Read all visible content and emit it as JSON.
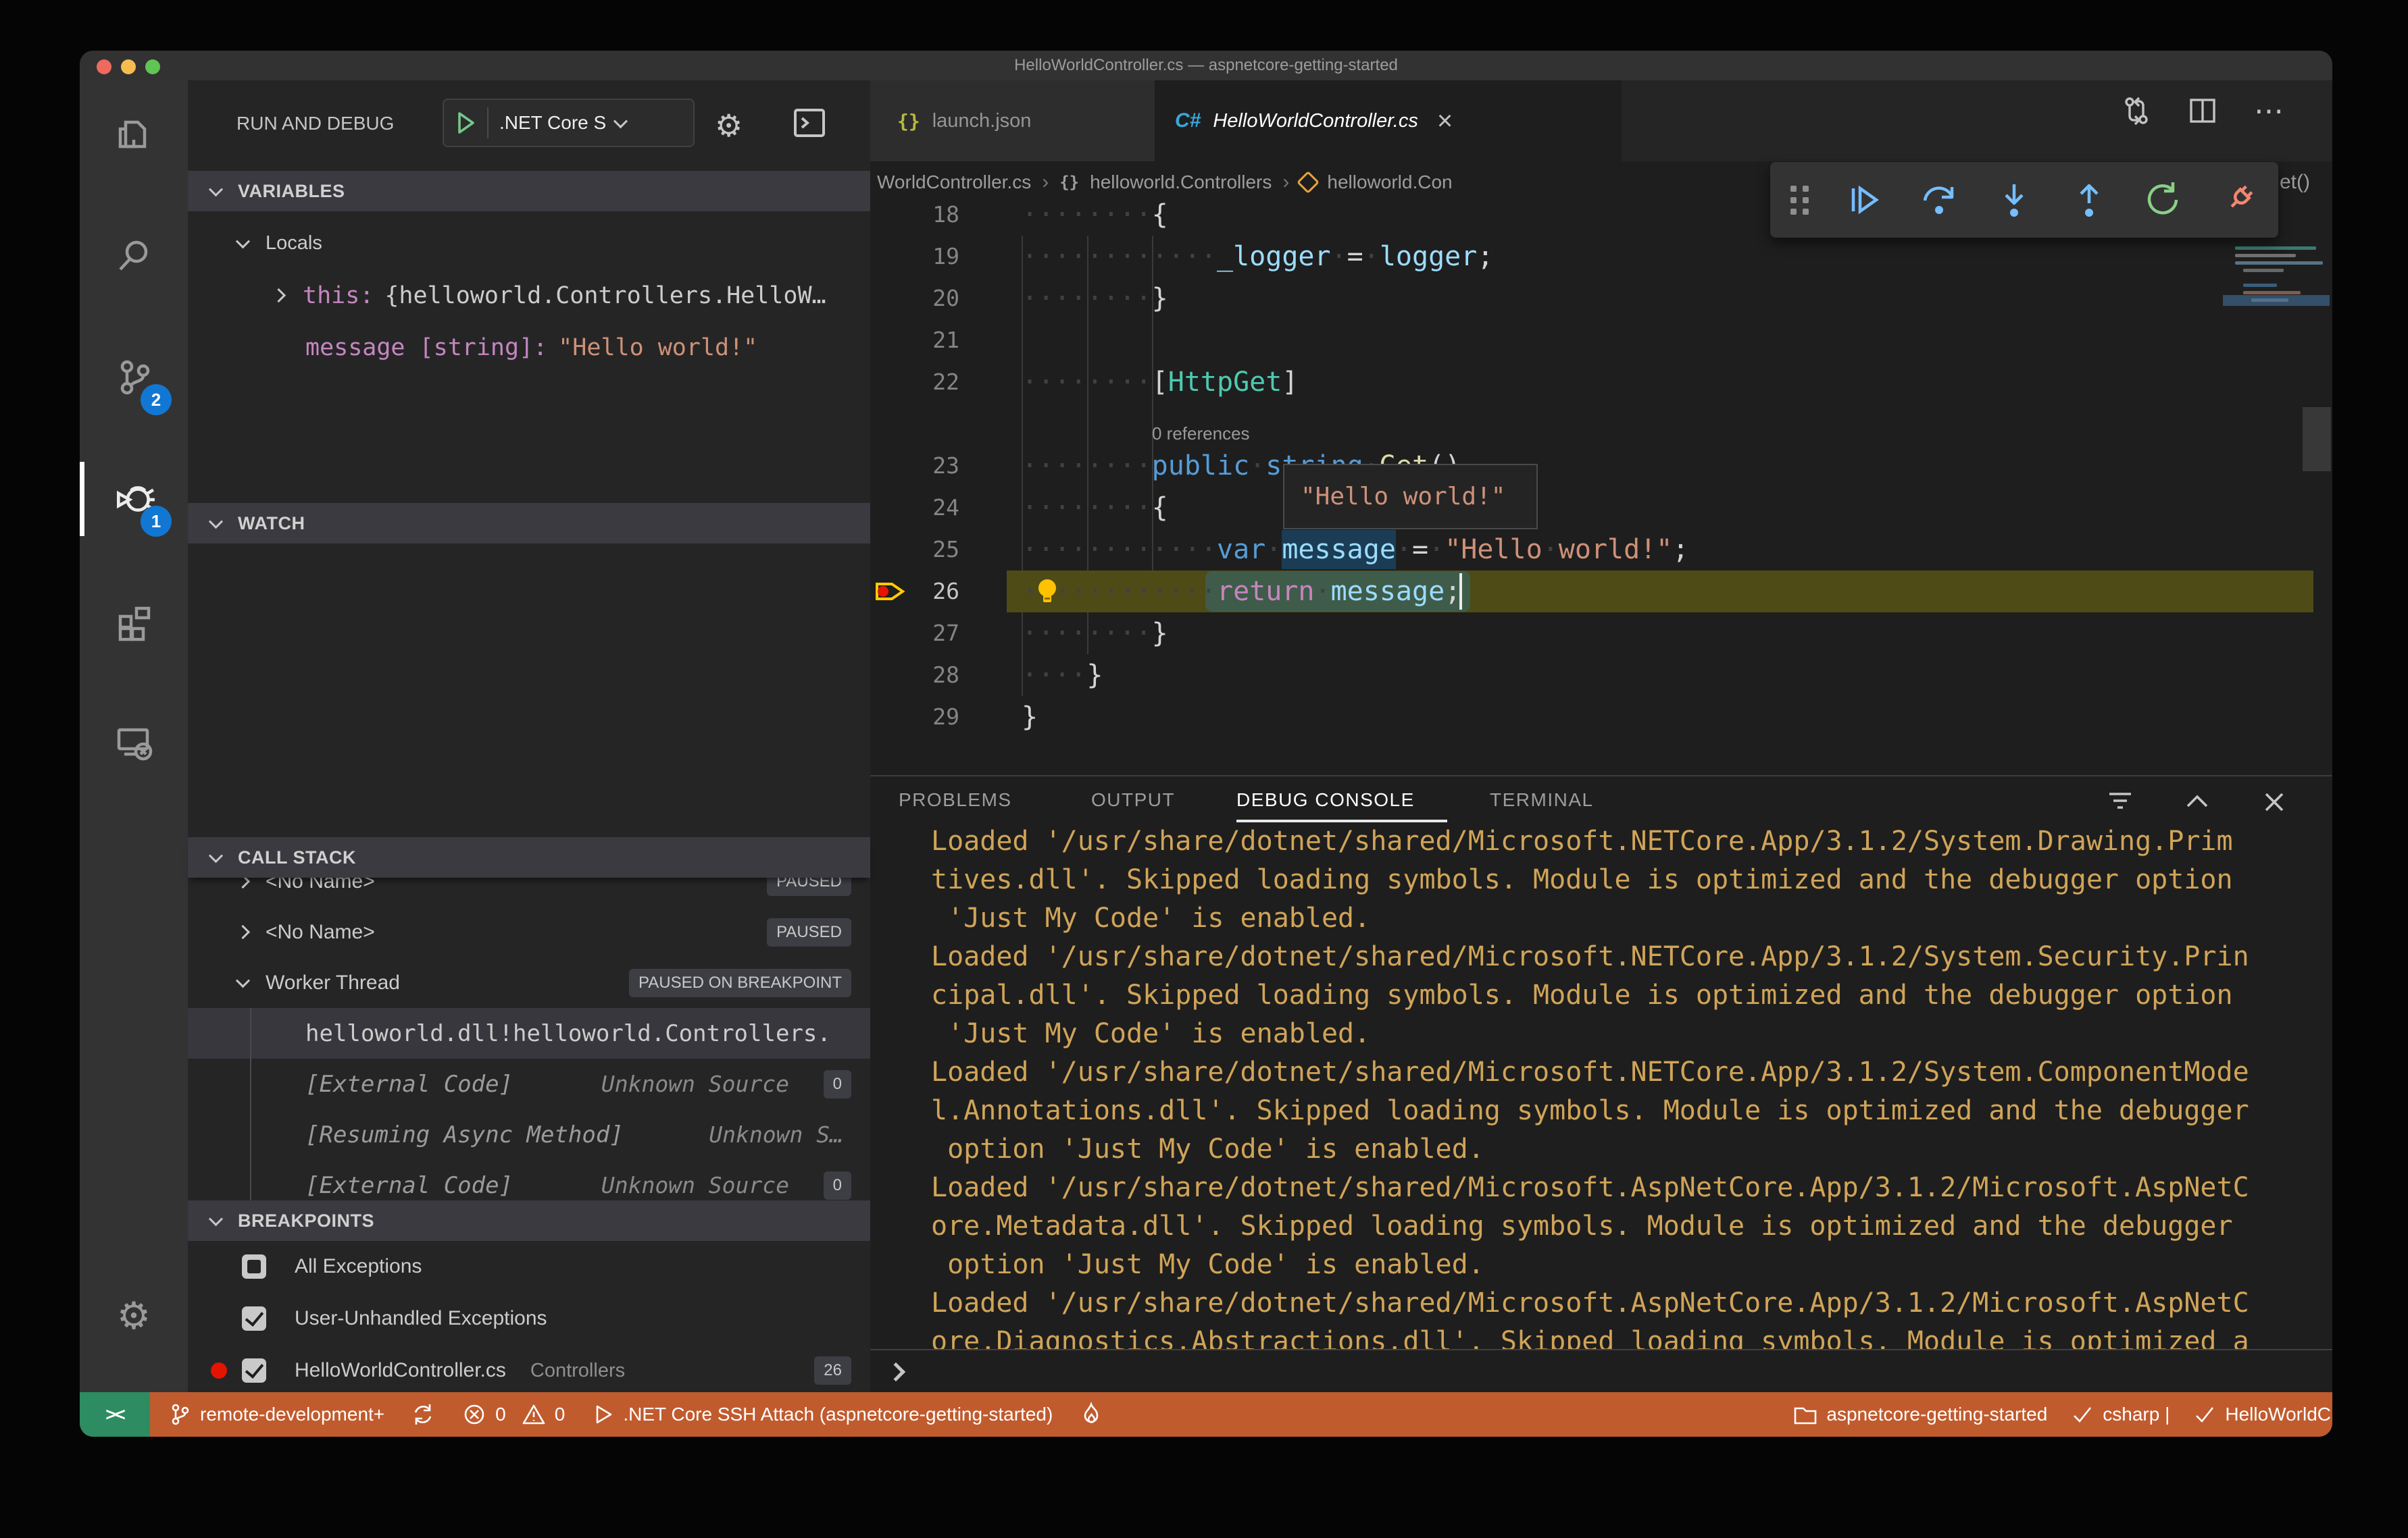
{
  "window": {
    "title": "HelloWorldController.cs — aspnetcore-getting-started"
  },
  "activity_bar": {
    "scm_badge": "2",
    "debug_badge": "1"
  },
  "run_bar": {
    "title": "RUN AND DEBUG",
    "config": ".NET Core S"
  },
  "sections": {
    "variables": "VARIABLES",
    "watch": "WATCH",
    "call_stack": "CALL STACK",
    "breakpoints": "BREAKPOINTS"
  },
  "variables": {
    "scope": "Locals",
    "rows": [
      {
        "name": "this:",
        "value": "{helloworld.Controllers.HelloW…"
      },
      {
        "name": "message [string]:",
        "value": "\"Hello world!\""
      }
    ]
  },
  "call_stack": {
    "rows": [
      {
        "label": "<No Name>",
        "chev": "r",
        "badge": "PAUSED",
        "clip": true
      },
      {
        "label": "<No Name>",
        "chev": "r",
        "badge": "PAUSED"
      },
      {
        "label": "Worker Thread",
        "chev": "d",
        "badge": "PAUSED ON BREAKPOINT"
      },
      {
        "label": "helloworld.dll!helloworld.Controllers.",
        "frame": true,
        "selected": true
      },
      {
        "label": "[External Code]",
        "frame": true,
        "dim": true,
        "right": "Unknown Source",
        "count": "0"
      },
      {
        "label": "[Resuming Async Method]",
        "frame": true,
        "dim": true,
        "right": "Unknown S…"
      },
      {
        "label": "[External Code]",
        "frame": true,
        "dim": true,
        "right": "Unknown Source",
        "count": "0"
      }
    ]
  },
  "breakpoints": {
    "rows": [
      {
        "label": "All Exceptions",
        "checked": false
      },
      {
        "label": "User-Unhandled Exceptions",
        "checked": true
      },
      {
        "label": "HelloWorldController.cs",
        "checked": true,
        "dot": true,
        "meta": "Controllers",
        "badge": "26"
      }
    ]
  },
  "tabs": {
    "tab1": {
      "label": "launch.json",
      "icon": "{}"
    },
    "tab2": {
      "label": "HelloWorldController.cs",
      "icon": "C#",
      "close": "×"
    }
  },
  "tabbar_more_icon": "⋯",
  "breadcrumb": {
    "seg1": "WorldController.cs",
    "sep": "›",
    "njs_icon": "{}",
    "seg2": "helloworld.Controllers",
    "seg3": "helloworld.Con",
    "tail": "et()"
  },
  "editor": {
    "code_lines": [
      {
        "n": "18",
        "idx": 0,
        "ws": 8,
        "tokens": [
          [
            "{",
            "pun"
          ]
        ]
      },
      {
        "n": "19",
        "idx": 1,
        "ws": 12,
        "tokens": [
          [
            "_logger",
            "var"
          ],
          [
            " ",
            "ws"
          ],
          [
            "=",
            "pun"
          ],
          [
            " ",
            "ws"
          ],
          [
            "logger",
            "var"
          ],
          [
            ";",
            "pun"
          ]
        ]
      },
      {
        "n": "20",
        "idx": 2,
        "ws": 8,
        "tokens": [
          [
            "}",
            "pun"
          ]
        ]
      },
      {
        "n": "21",
        "idx": 3,
        "ws": 0,
        "tokens": []
      },
      {
        "n": "22",
        "idx": 4,
        "ws": 8,
        "tokens": [
          [
            "[",
            "pun"
          ],
          [
            "HttpGet",
            "type"
          ],
          [
            "]",
            "pun"
          ]
        ]
      },
      {
        "lens": "0 references",
        "idx": 5
      },
      {
        "n": "23",
        "idx": 6,
        "ws": 8,
        "tokens": [
          [
            "public",
            "kw"
          ],
          [
            " ",
            "ws"
          ],
          [
            "string",
            "kw"
          ],
          [
            " ",
            "ws"
          ],
          [
            "Get",
            "meth"
          ],
          [
            "()",
            "pun"
          ]
        ]
      },
      {
        "n": "24",
        "idx": 7,
        "ws": 8,
        "tokens": [
          [
            "{",
            "pun"
          ]
        ]
      },
      {
        "n": "25",
        "idx": 8,
        "ws": 12,
        "tokens": [
          [
            "var",
            "kw"
          ],
          [
            " ",
            "ws"
          ],
          [
            "message",
            "var word"
          ],
          [
            " ",
            "ws"
          ],
          [
            "=",
            "pun"
          ],
          [
            " ",
            "ws"
          ],
          [
            "\"Hello",
            "str"
          ],
          [
            " ",
            "ws"
          ],
          [
            "world!\"",
            "str"
          ],
          [
            ";",
            "pun"
          ]
        ]
      },
      {
        "n": "26",
        "idx": 9,
        "ws": 12,
        "current": true,
        "boxed": true,
        "cursor": true,
        "tokens": [
          [
            "return",
            "kwctl"
          ],
          [
            " ",
            "ws"
          ],
          [
            "message",
            "var"
          ],
          [
            ";",
            "pun"
          ]
        ]
      },
      {
        "n": "27",
        "idx": 10,
        "ws": 8,
        "tokens": [
          [
            "}",
            "pun"
          ]
        ]
      },
      {
        "n": "28",
        "idx": 11,
        "ws": 4,
        "tokens": [
          [
            "}",
            "pun"
          ]
        ]
      },
      {
        "n": "29",
        "idx": 12,
        "ws": 0,
        "tokens": [
          [
            "}",
            "pun"
          ]
        ]
      }
    ],
    "tooltip": "\"Hello world!\""
  },
  "panel": {
    "tabs": [
      "PROBLEMS",
      "OUTPUT",
      "DEBUG CONSOLE",
      "TERMINAL"
    ],
    "console_lines": [
      "Loaded '/usr/share/dotnet/shared/Microsoft.NETCore.App/3.1.2/System.Drawing.Prim",
      "tives.dll'. Skipped loading symbols. Module is optimized and the debugger option",
      " 'Just My Code' is enabled.",
      "Loaded '/usr/share/dotnet/shared/Microsoft.NETCore.App/3.1.2/System.Security.Prin",
      "cipal.dll'. Skipped loading symbols. Module is optimized and the debugger option",
      " 'Just My Code' is enabled.",
      "Loaded '/usr/share/dotnet/shared/Microsoft.NETCore.App/3.1.2/System.ComponentMode",
      "l.Annotations.dll'. Skipped loading symbols. Module is optimized and the debugger",
      " option 'Just My Code' is enabled.",
      "Loaded '/usr/share/dotnet/shared/Microsoft.AspNetCore.App/3.1.2/Microsoft.AspNetC",
      "ore.Metadata.dll'. Skipped loading symbols. Module is optimized and the debugger",
      " option 'Just My Code' is enabled.",
      "Loaded '/usr/share/dotnet/shared/Microsoft.AspNetCore.App/3.1.2/Microsoft.AspNetC",
      "ore.Diagnostics.Abstractions.dll'. Skipped loading symbols. Module is optimized a"
    ]
  },
  "status_bar": {
    "remote_icon": "><",
    "branch": "remote-development+",
    "errors": "0",
    "warnings": "0",
    "debug_session": ".NET Core SSH Attach (aspnetcore-getting-started)",
    "folder": "aspnetcore-getting-started",
    "check1": "csharp |",
    "check2": "HelloWorldC"
  }
}
